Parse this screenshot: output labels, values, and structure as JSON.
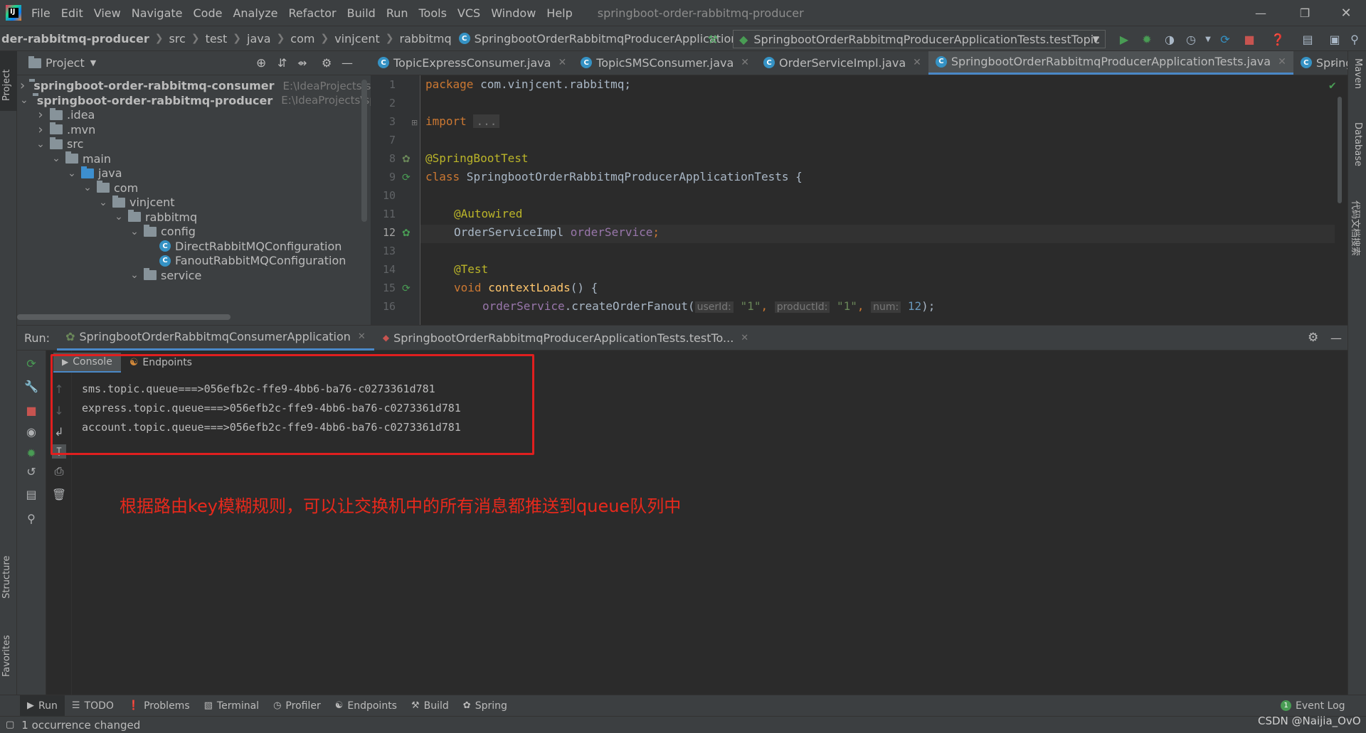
{
  "menubar": {
    "items": [
      "File",
      "Edit",
      "View",
      "Navigate",
      "Code",
      "Analyze",
      "Refactor",
      "Build",
      "Run",
      "Tools",
      "VCS",
      "Window",
      "Help"
    ],
    "title": "springboot-order-rabbitmq-producer"
  },
  "breadcrumb": {
    "items": [
      "der-rabbitmq-producer",
      "src",
      "test",
      "java",
      "com",
      "vinjcent",
      "rabbitmq",
      "SpringbootOrderRabbitmqProducerApplicationTests"
    ]
  },
  "run_config": {
    "selected": "SpringbootOrderRabbitmqProducerApplicationTests.testTopic"
  },
  "sidebar_tabs": {
    "project": "Project",
    "structure": "Structure",
    "favorites": "Favorites"
  },
  "right_tabs": {
    "maven": "Maven",
    "database": "Database",
    "search": "代码文档搜索"
  },
  "project_panel": {
    "title": "Project",
    "tree": [
      {
        "label": "springboot-order-rabbitmq-consumer",
        "hint": "E:\\IdeaProjects\\spri",
        "depth": 0,
        "expanded": false,
        "type": "module"
      },
      {
        "label": "springboot-order-rabbitmq-producer",
        "hint": "E:\\IdeaProjects\\sprir",
        "depth": 0,
        "expanded": true,
        "type": "module"
      },
      {
        "label": ".idea",
        "hint": "",
        "depth": 1,
        "expanded": false,
        "type": "folder"
      },
      {
        "label": ".mvn",
        "hint": "",
        "depth": 1,
        "expanded": false,
        "type": "folder"
      },
      {
        "label": "src",
        "hint": "",
        "depth": 1,
        "expanded": true,
        "type": "folder"
      },
      {
        "label": "main",
        "hint": "",
        "depth": 2,
        "expanded": true,
        "type": "folder"
      },
      {
        "label": "java",
        "hint": "",
        "depth": 3,
        "expanded": true,
        "type": "source"
      },
      {
        "label": "com",
        "hint": "",
        "depth": 4,
        "expanded": true,
        "type": "package"
      },
      {
        "label": "vinjcent",
        "hint": "",
        "depth": 5,
        "expanded": true,
        "type": "package"
      },
      {
        "label": "rabbitmq",
        "hint": "",
        "depth": 6,
        "expanded": true,
        "type": "package"
      },
      {
        "label": "config",
        "hint": "",
        "depth": 7,
        "expanded": true,
        "type": "package"
      },
      {
        "label": "DirectRabbitMQConfiguration",
        "hint": "",
        "depth": 8,
        "expanded": null,
        "type": "class"
      },
      {
        "label": "FanoutRabbitMQConfiguration",
        "hint": "",
        "depth": 8,
        "expanded": null,
        "type": "class"
      },
      {
        "label": "service",
        "hint": "",
        "depth": 7,
        "expanded": true,
        "type": "package"
      }
    ]
  },
  "editor": {
    "tabs": [
      {
        "label": "TopicExpressConsumer.java",
        "active": false
      },
      {
        "label": "TopicSMSConsumer.java",
        "active": false
      },
      {
        "label": "OrderServiceImpl.java",
        "active": false
      },
      {
        "label": "SpringbootOrderRabbitmqProducerApplicationTests.java",
        "active": true
      },
      {
        "label": "SpringbootC",
        "active": false
      }
    ],
    "line_numbers": [
      "1",
      "2",
      "3",
      "7",
      "8",
      "9",
      "10",
      "11",
      "12",
      "13",
      "14",
      "15",
      "16"
    ],
    "code": {
      "l1_kw": "package",
      "l1_rest": " com.vinjcent.rabbitmq;",
      "l3_kw": "import",
      "l3_fold": "...",
      "l8": "@SpringBootTest",
      "l9_kw": "class",
      "l9_rest": " SpringbootOrderRabbitmqProducerApplicationTests {",
      "l11": "@Autowired",
      "l12_type": "OrderServiceImpl ",
      "l12_field": "orderService",
      "l12_semi": ";",
      "l14": "@Test",
      "l15_kw": "void",
      "l15_m": "contextLoads",
      "l15_rest": "() {",
      "l16_field": "orderService",
      "l16_call": ".createOrderFanout(",
      "l16_h1": "userId:",
      "l16_v1": "\"1\"",
      "l16_h2": "productId:",
      "l16_v2": "\"1\"",
      "l16_h3": "num:",
      "l16_v3": "12",
      "l16_end": ");"
    }
  },
  "run_panel": {
    "label": "Run:",
    "tabs": [
      {
        "label": "SpringbootOrderRabbitmqConsumerApplication",
        "active": true
      },
      {
        "label": "SpringbootOrderRabbitmqProducerApplicationTests.testTo...",
        "active": false
      }
    ],
    "subtabs": [
      "Console",
      "Endpoints"
    ],
    "console_lines": [
      "sms.topic.queue===>056efb2c-ffe9-4bb6-ba76-c0273361d781",
      "express.topic.queue===>056efb2c-ffe9-4bb6-ba76-c0273361d781",
      "account.topic.queue===>056efb2c-ffe9-4bb6-ba76-c0273361d781"
    ],
    "annotation": "根据路由key模糊规则，可以让交换机中的所有消息都推送到queue队列中"
  },
  "bottom_tools": [
    {
      "label": "Run",
      "icon": "run-icon",
      "active": true
    },
    {
      "label": "TODO",
      "icon": "list-icon",
      "active": false
    },
    {
      "label": "Problems",
      "icon": "problems-icon",
      "active": false
    },
    {
      "label": "Terminal",
      "icon": "terminal-icon",
      "active": false
    },
    {
      "label": "Profiler",
      "icon": "profiler-icon",
      "active": false
    },
    {
      "label": "Endpoints",
      "icon": "endpoints-icon",
      "active": false
    },
    {
      "label": "Build",
      "icon": "hammer-icon",
      "active": false
    },
    {
      "label": "Spring",
      "icon": "spring-icon",
      "active": false
    }
  ],
  "event_log": {
    "count": "1",
    "label": "Event Log"
  },
  "status": {
    "message": "1 occurrence changed",
    "watermark": "CSDN @Naijia_OvO"
  },
  "colors": {
    "accent": "#4a88c7",
    "annotation_red": "#e8291c",
    "run_green": "#499c54",
    "stop_red": "#c75450"
  }
}
